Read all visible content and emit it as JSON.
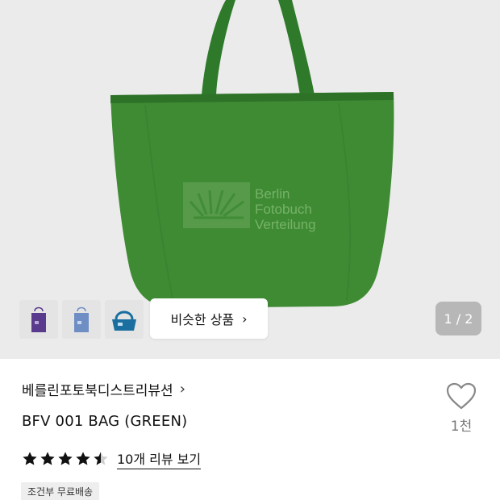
{
  "product_image": {
    "logo_lines": [
      "Berlin",
      "Fotobuch",
      "Verteilung"
    ],
    "bag_color": "#3f8b34",
    "page_indicator": "1 / 2"
  },
  "thumbnails": [
    {
      "name": "purple-bag-thumbnail",
      "color": "#5a3a8c"
    },
    {
      "name": "blue-bag-thumbnail",
      "color": "#6f8fc4"
    },
    {
      "name": "teal-bag-thumbnail",
      "color": "#1a6fa0"
    }
  ],
  "similar_button": {
    "label": "비슷한 상품",
    "chevron": "›"
  },
  "brand": {
    "name": "베를린포토북디스트리뷰션",
    "chevron": "›"
  },
  "product": {
    "name": "BFV 001 BAG (GREEN)"
  },
  "likes": {
    "count": "1천",
    "icon": "heart-outline-icon"
  },
  "rating": {
    "value": 4.5,
    "max": 5,
    "review_link": "10개 리뷰 보기"
  },
  "shipping": {
    "badge": "조건부 무료배송"
  }
}
